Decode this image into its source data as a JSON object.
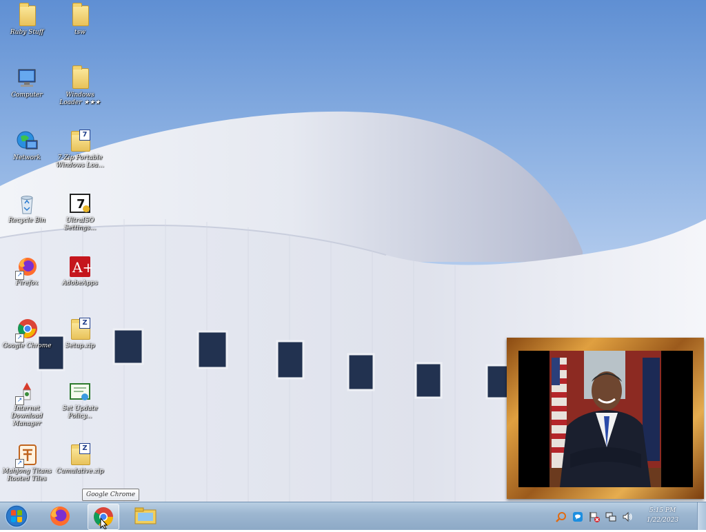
{
  "desktop": {
    "icons": [
      {
        "label": "Ruby Stuff"
      },
      {
        "label": "tsw"
      },
      {
        "label": "Computer"
      },
      {
        "label": "Windows Loader ★★★"
      },
      {
        "label": "Network"
      },
      {
        "label": "7-Zip Portable Windows Loa..."
      },
      {
        "label": "Recycle Bin"
      },
      {
        "label": "UltraISO Settings..."
      },
      {
        "label": "Firefox"
      },
      {
        "label": "AdobeApps"
      },
      {
        "label": "Google Chrome"
      },
      {
        "label": "Setup.zip"
      },
      {
        "label": "Internet Download Manager"
      },
      {
        "label": "Set Update Policy..."
      },
      {
        "label": "Mahjong Titans Rooted Tiles"
      },
      {
        "label": "Cumulative.zip"
      }
    ],
    "photo_frame": {
      "description_icon": "framed-portrait-photo"
    }
  },
  "tooltip": {
    "text": "Google Chrome"
  },
  "taskbar": {
    "start_icon": "windows-start-orb",
    "pinned": [
      {
        "name": "firefox",
        "icon": "firefox-icon"
      },
      {
        "name": "chrome",
        "icon": "chrome-icon",
        "active": true
      },
      {
        "name": "explorer",
        "icon": "folder-icon"
      }
    ],
    "tray": [
      {
        "icon": "search-magnifier-icon"
      },
      {
        "icon": "chat-bubble-icon"
      },
      {
        "icon": "action-center-flag-icon"
      },
      {
        "icon": "network-icon"
      },
      {
        "icon": "volume-icon"
      }
    ],
    "clock": {
      "time": "5:15 PM",
      "date": "1/22/2023"
    }
  },
  "colors": {
    "taskbar": "#9db7d1",
    "frame_gold": "#e0a040",
    "sky": "#6f98d8"
  }
}
